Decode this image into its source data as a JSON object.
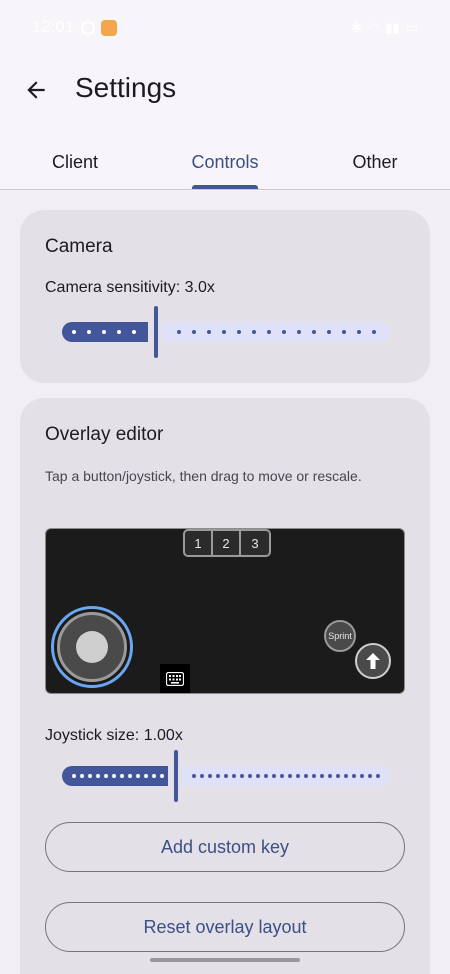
{
  "status_bar": {
    "time": "12:01"
  },
  "header": {
    "title": "Settings"
  },
  "tabs": [
    {
      "label": "Client"
    },
    {
      "label": "Controls"
    },
    {
      "label": "Other"
    }
  ],
  "active_tab": "Controls",
  "camera_card": {
    "title": "Camera",
    "sensitivity_label": "Camera sensitivity: 3.0x",
    "sensitivity_fraction": 0.28
  },
  "overlay_card": {
    "title": "Overlay editor",
    "hint": "Tap a button/joystick, then drag to move or rescale.",
    "hotbar": [
      "1",
      "2",
      "3"
    ],
    "sprint_label": "Sprint",
    "joystick_label": "Joystick size: 1.00x",
    "joystick_fraction": 0.34,
    "add_key_label": "Add custom key",
    "reset_label": "Reset overlay layout"
  },
  "colors": {
    "accent": "#44569a",
    "track_inactive": "#dfe1f8",
    "joystick_highlight": "#6aa6f2"
  }
}
